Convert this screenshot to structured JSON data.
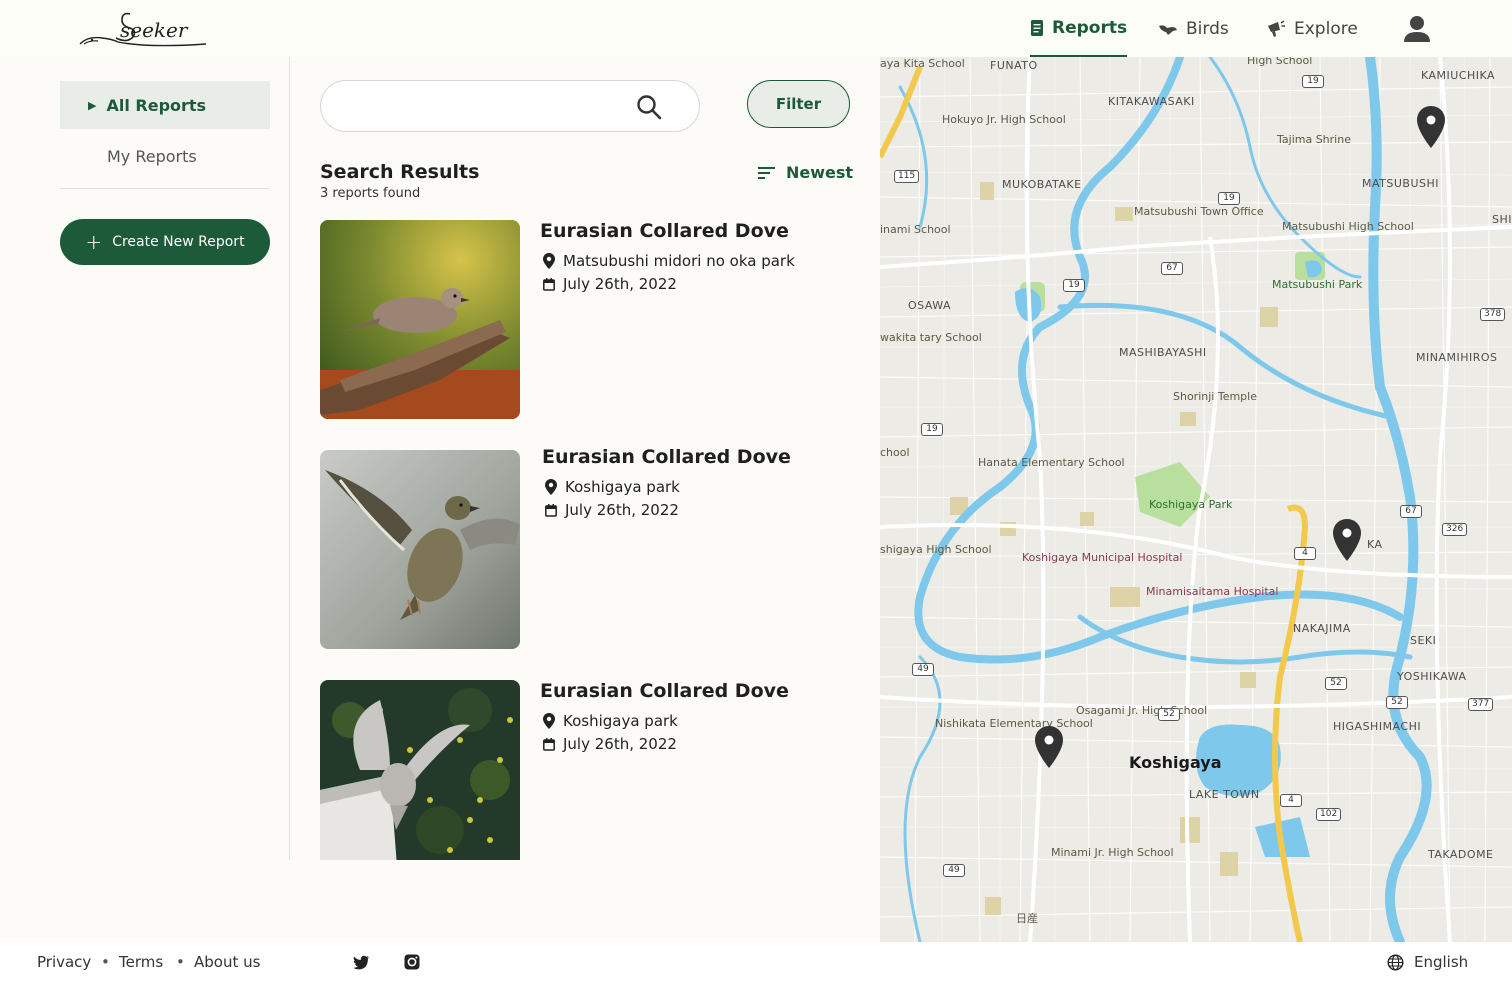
{
  "header": {
    "logo_text": "seeker",
    "nav": {
      "reports": "Reports",
      "birds": "Birds",
      "explore": "Explore"
    }
  },
  "sidebar": {
    "all_reports": "All Reports",
    "my_reports": "My Reports",
    "create_button": "Create New Report"
  },
  "search": {
    "value": "",
    "filter_label": "Filter"
  },
  "results": {
    "title": "Search Results",
    "count_text": "3 reports found",
    "sort_label": "Newest",
    "items": [
      {
        "title": "Eurasian Collared Dove",
        "location": "Matsubushi midori no oka park",
        "date": "July 26th, 2022"
      },
      {
        "title": "Eurasian Collared Dove",
        "location": "Koshigaya park",
        "date": "July 26th, 2022"
      },
      {
        "title": "Eurasian Collared Dove",
        "location": "Koshigaya park",
        "date": "July 26th, 2022"
      }
    ]
  },
  "map": {
    "areas": {
      "funato": "FUNATO",
      "kitakawasaki": "KITAKAWASAKI",
      "kamiuchika": "KAMIUCHIKA",
      "mukobatake": "MUKOBATAKE",
      "matsubushi": "MATSUBUSHI",
      "osawa": "OSAWA",
      "mashibayashi": "MASHIBAYASHI",
      "minamihiros": "MINAMIHIROS",
      "nakajima": "NAKAJIMA",
      "seki": "SEKI",
      "yoshikawa": "YOSHIKAWA",
      "higashimachi": "HIGASHIMACHI",
      "lake_town": "LAKE TOWN",
      "takadome": "TAKADOME",
      "shi": "SHI",
      "ka": "KA"
    },
    "city": "Koshigaya",
    "pois": {
      "kita_school": "aya Kita School",
      "hokuyo": "Hokuyo Jr. High School",
      "high_school_top": "High School",
      "tajima": "Tajima Shrine",
      "town_office": "Matsubushi Town Office",
      "matsubushi_hs": "Matsubushi High School",
      "matsubushi_park": "Matsubushi Park",
      "inami_school": "inami School",
      "iwakita": "wakita tary School",
      "shorinji": "Shorinji Temple",
      "hanata": "Hanata Elementary School",
      "koshigaya_park": "Koshigaya Park",
      "koshigaya_hs": "shigaya High School",
      "hospital": "Koshigaya Municipal Hospital",
      "minamisaitama": "Minamisaitama Hospital",
      "osagami": "Osagami Jr. High School",
      "nishikata": "Nishikata Elementary School",
      "minami_jr": "Minami Jr. High School",
      "nissan": "日産",
      "chool": "chool"
    },
    "routes": [
      "19",
      "115",
      "19",
      "67",
      "19",
      "19",
      "378",
      "67",
      "326",
      "4",
      "52",
      "49",
      "52",
      "52",
      "377",
      "4",
      "102",
      "49"
    ]
  },
  "footer": {
    "privacy": "Privacy",
    "terms": "Terms",
    "about": "About us",
    "language": "English"
  },
  "colors": {
    "brand": "#1d5a3a",
    "brand_light": "#e8eee7",
    "water": "#7ec8ec",
    "highway": "#f2c94c",
    "park": "#b9df9e"
  }
}
